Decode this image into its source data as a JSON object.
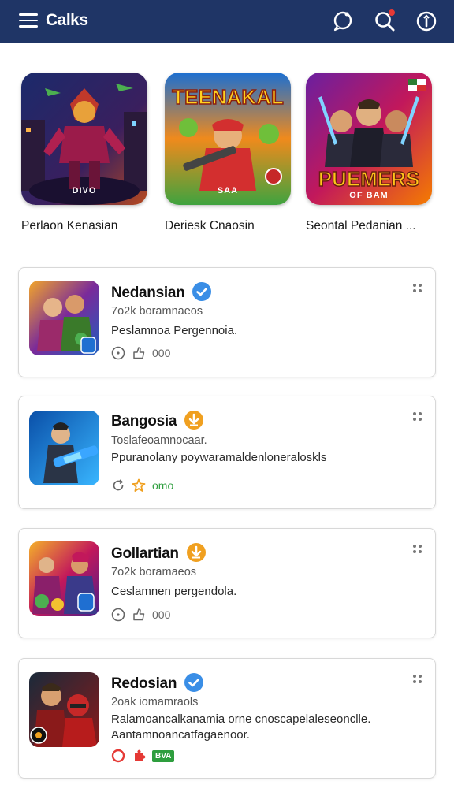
{
  "header": {
    "title": "Calks",
    "background": "#1f3566"
  },
  "featured": [
    {
      "title": "Perlaon Kenasian",
      "badge": "DIVO",
      "colors": [
        "#2b1f6e",
        "#c0392b"
      ]
    },
    {
      "title": "Deriesk Cnaosin",
      "badge": "SAA",
      "art_text": "TEENAKAL",
      "colors": [
        "#e0401c",
        "#f5c400"
      ]
    },
    {
      "title": "Seontal Pedanian ...",
      "badge": "OF BAM",
      "art_text": "PUEMERS",
      "colors": [
        "#5a1c8c",
        "#e84a1c"
      ]
    }
  ],
  "list": [
    {
      "name": "Nedansian",
      "badge": "verified",
      "badge_color": "#3a8ee6",
      "subtitle": "7o2k boramnaeos",
      "desc_lines": [
        "Peslamnoa Pergennoia."
      ],
      "meta_text": "000",
      "meta_color": "#666666"
    },
    {
      "name": "Bangosia",
      "badge": "download",
      "badge_color": "#f0a020",
      "subtitle": "Toslafeoamnocaar.",
      "desc_lines": [
        "Ppuranolany poywaramaldenloneraloskls"
      ],
      "meta_text": "omo",
      "meta_color": "#2e9e3e"
    },
    {
      "name": "Gollartian",
      "badge": "download",
      "badge_color": "#f0a020",
      "subtitle": "7o2k boramaeos",
      "desc_lines": [
        "Ceslamnen pergendola."
      ],
      "meta_text": "000",
      "meta_color": "#666666"
    },
    {
      "name": "Redosian",
      "badge": "verified",
      "badge_color": "#3a8ee6",
      "subtitle": "2oak iomamraols",
      "desc_lines": [
        "Ralamoancalkanamia orne cnoscapelaleseonclle.",
        "Aantamnoancatfagaenoor."
      ],
      "meta_text": "BVA",
      "meta_color": "#e53935"
    }
  ]
}
